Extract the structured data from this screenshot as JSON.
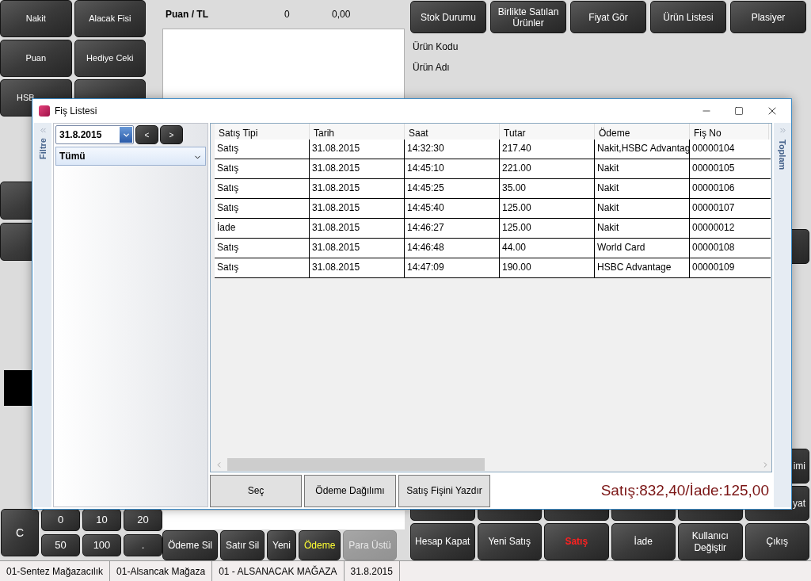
{
  "payment_buttons": [
    "Nakit",
    "Alacak Fisi",
    "Puan",
    "Hediye Ceki",
    "HSB"
  ],
  "points": {
    "label": "Puan / TL",
    "count": "0",
    "amount": "0,00"
  },
  "top_buttons": [
    "Stok Durumu",
    "Birlikte Satılan Ürünler",
    "Fiyat Gör",
    "Ürün Listesi",
    "Plasiyer"
  ],
  "product_fields": [
    "Ürün Kodu",
    "Ürün Adı"
  ],
  "keypad": {
    "clear": "C",
    "keys": [
      "0",
      "10",
      "20",
      "50",
      "100",
      "."
    ]
  },
  "line_buttons": [
    {
      "label": "Ödeme Sil",
      "highlighted": false,
      "disabled": false
    },
    {
      "label": "Satır Sil",
      "highlighted": false,
      "disabled": false
    },
    {
      "label": "Yeni",
      "highlighted": false,
      "disabled": false
    },
    {
      "label": "Ödeme",
      "highlighted": true,
      "disabled": false
    },
    {
      "label": "Para Üstü",
      "highlighted": false,
      "disabled": true
    }
  ],
  "side_buttons": [
    "imi",
    "yat"
  ],
  "action_buttons": [
    {
      "label": "Hesap Kapat",
      "selected": false
    },
    {
      "label": "Yeni Satış",
      "selected": false
    },
    {
      "label": "Satış",
      "selected": true
    },
    {
      "label": "İade",
      "selected": false
    },
    {
      "label": "Kullanıcı Değiştir",
      "selected": false
    },
    {
      "label": "Çıkış",
      "selected": false
    }
  ],
  "status_bar": [
    "01-Sentez Mağazacılık",
    "01-Alsancak Mağaza",
    "01 - ALSANACAK MAĞAZA",
    "31.8.2015"
  ],
  "dialog": {
    "title": "Fiş Listesi",
    "filter_tab": "Filtre",
    "totals_tab": "Toplam",
    "date": "31.8.2015",
    "prev": "<",
    "next": ">",
    "type_filter": "Tümü",
    "table": {
      "columns": [
        "Satış Tipi",
        "Tarih",
        "Saat",
        "Tutar",
        "Ödeme",
        "Fiş No"
      ],
      "rows": [
        [
          "Satış",
          "31.08.2015",
          "14:32:30",
          "217.40",
          "Nakit,HSBC Advantag",
          "00000104"
        ],
        [
          "Satış",
          "31.08.2015",
          "14:45:10",
          "221.00",
          "Nakit",
          "00000105"
        ],
        [
          "Satış",
          "31.08.2015",
          "14:45:25",
          "35.00",
          "Nakit",
          "00000106"
        ],
        [
          "Satış",
          "31.08.2015",
          "14:45:40",
          "125.00",
          "Nakit",
          "00000107"
        ],
        [
          "İade",
          "31.08.2015",
          "14:46:27",
          "125.00",
          "Nakit",
          "00000012"
        ],
        [
          "Satış",
          "31.08.2015",
          "14:46:48",
          "44.00",
          "World Card",
          "00000108"
        ],
        [
          "Satış",
          "31.08.2015",
          "14:47:09",
          "190.00",
          "HSBC Advantage",
          "00000109"
        ]
      ]
    },
    "buttons": [
      "Seç",
      "Ödeme Dağılımı",
      "Satış Fişini Yazdır"
    ],
    "summary": "Satış:832,40/İade:125,00"
  }
}
